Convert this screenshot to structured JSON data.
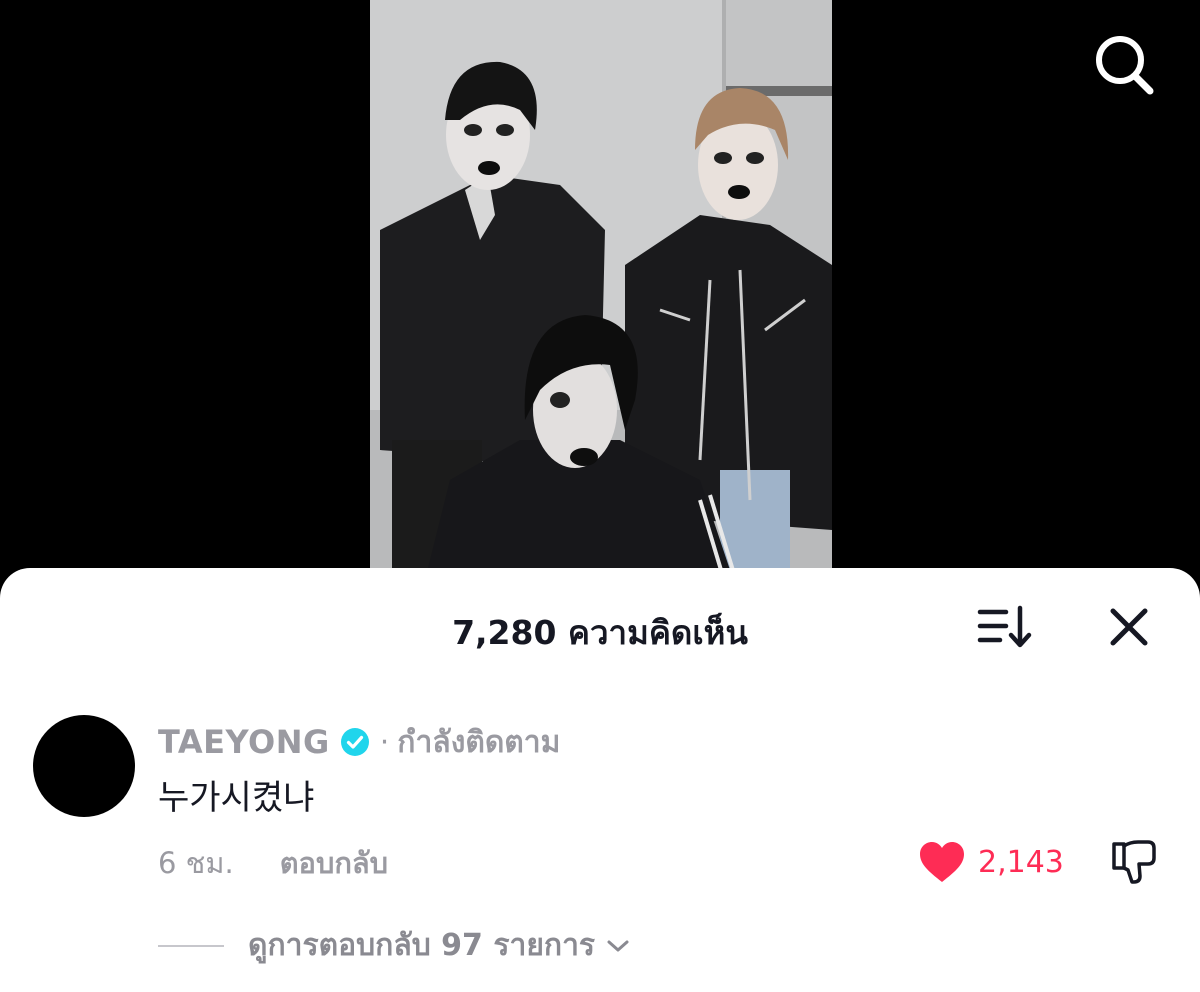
{
  "video": {
    "description_icon": "video-frame"
  },
  "search": {
    "icon": "search-icon"
  },
  "comments_sheet": {
    "count_label": "7,280 ความคิดเห็น",
    "sort_icon": "sort-icon",
    "close_icon": "close-icon"
  },
  "comment": {
    "username": "TAEYONG",
    "verified": true,
    "separator": "·",
    "follow_status": "กำลังติดตาม",
    "text": "누가시켰냐",
    "time": "6 ชม.",
    "reply_label": "ตอบกลับ",
    "like_count": "2,143",
    "liked": true,
    "view_replies_label": "ดูการตอบกลับ 97 รายการ"
  },
  "colors": {
    "like_red": "#fe2c55",
    "verified_blue": "#20d5ec",
    "muted_text": "#9a9aa1",
    "primary_text": "#161823"
  }
}
